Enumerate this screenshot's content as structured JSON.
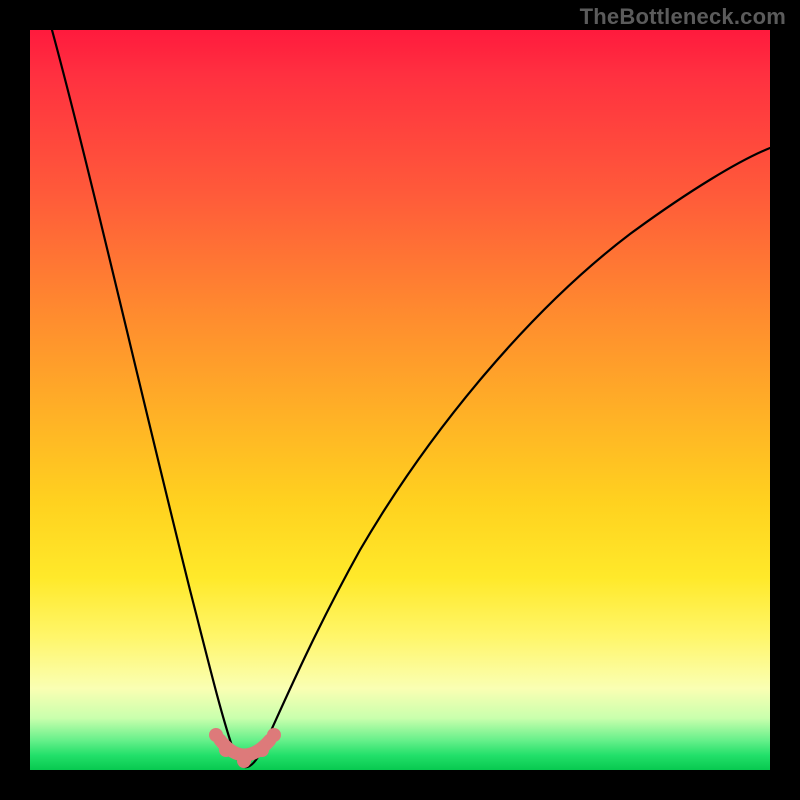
{
  "watermark": "TheBottleneck.com",
  "chart_data": {
    "type": "line",
    "title": "",
    "xlabel": "",
    "ylabel": "",
    "xlim": [
      0,
      100
    ],
    "ylim": [
      0,
      100
    ],
    "grid": false,
    "background_gradient": {
      "direction": "vertical",
      "stops": [
        {
          "pos": 0,
          "color": "#ff1a3d"
        },
        {
          "pos": 50,
          "color": "#ffb126"
        },
        {
          "pos": 80,
          "color": "#fff66a"
        },
        {
          "pos": 95,
          "color": "#66f08a"
        },
        {
          "pos": 100,
          "color": "#07c94f"
        }
      ]
    },
    "series": [
      {
        "name": "bottleneck-curve",
        "color": "#000000",
        "x": [
          3,
          6,
          10,
          14,
          18,
          22,
          24,
          26,
          27,
          28,
          29,
          30,
          31,
          33,
          36,
          40,
          46,
          54,
          64,
          76,
          88,
          100
        ],
        "y": [
          100,
          90,
          76,
          61,
          45,
          27,
          17,
          8,
          3,
          0,
          0,
          1,
          3,
          8,
          15,
          24,
          35,
          47,
          58,
          68,
          76,
          82
        ]
      }
    ],
    "markers": {
      "name": "optimal-region",
      "color": "#dd7a7a",
      "x": [
        24.5,
        25.5,
        27,
        29,
        31,
        32.5,
        33.5
      ],
      "y": [
        5,
        3,
        1,
        0,
        1,
        3,
        5
      ]
    }
  }
}
